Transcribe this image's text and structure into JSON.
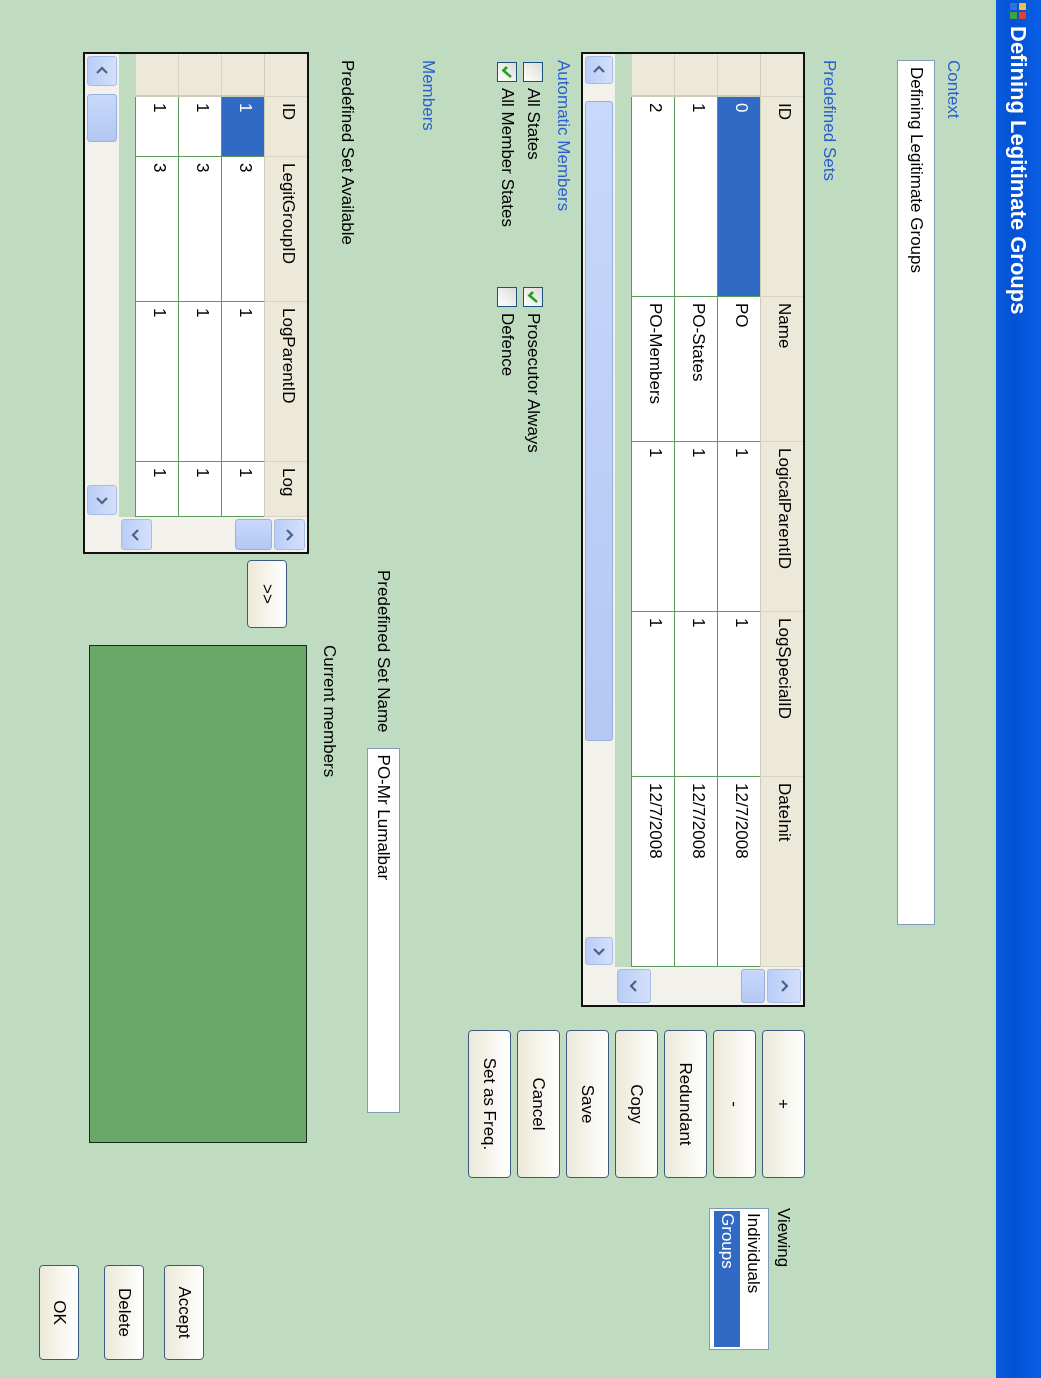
{
  "window": {
    "title": "Defining Legitimate Groups"
  },
  "context": {
    "label": "Context",
    "value": "Defining Legitimate Groups"
  },
  "predefined_sets": {
    "label": "Predefined Sets",
    "columns": [
      "ID",
      "Name",
      "LogicalParentID",
      "LogSpecialID",
      "DateInit"
    ],
    "records": [
      {
        "id": "0",
        "name": "PO",
        "logical_parent_id": "1",
        "log_special_id": "1",
        "date_init": "12/7/2008",
        "selected": true
      },
      {
        "id": "1",
        "name": "PO-States",
        "logical_parent_id": "1",
        "log_special_id": "1",
        "date_init": "12/7/2008",
        "selected": false
      },
      {
        "id": "2",
        "name": "PO-Members",
        "logical_parent_id": "1",
        "log_special_id": "1",
        "date_init": "12/7/2008",
        "selected": false
      }
    ]
  },
  "automatic_members": {
    "label": "Automatic Members",
    "checkboxes": [
      {
        "label": "All States",
        "checked": false
      },
      {
        "label": "Prosecutor Always",
        "checked": true
      },
      {
        "label": "All Member States",
        "checked": true
      },
      {
        "label": "Defence",
        "checked": false
      }
    ]
  },
  "actions": [
    "+",
    "-",
    "Redundant",
    "Copy",
    "Save",
    "Cancel",
    "Set as Freq."
  ],
  "viewing": {
    "label": "Viewing",
    "items": [
      {
        "label": "Individuals",
        "selected": false
      },
      {
        "label": "Groups",
        "selected": true
      }
    ]
  },
  "members": {
    "label": "Members",
    "set_name_label": "Predefined Set Name",
    "set_name_value": "PO-Mr Lumalbar",
    "available_label": "Predefined Set Available",
    "current_label": "Current members",
    "move_button": ">>",
    "available": {
      "columns": [
        "ID",
        "LegitGroupID",
        "LogParentID",
        "Log"
      ],
      "records": [
        {
          "id": "1",
          "legit_group_id": "3",
          "log_parent_id": "1",
          "log": "1",
          "selected": true
        },
        {
          "id": "1",
          "legit_group_id": "3",
          "log_parent_id": "1",
          "log": "1",
          "selected": false
        },
        {
          "id": "1",
          "legit_group_id": "3",
          "log_parent_id": "1",
          "log": "1",
          "selected": false
        }
      ]
    }
  },
  "dialog_buttons": [
    "Accept",
    "Delete",
    "OK"
  ]
}
